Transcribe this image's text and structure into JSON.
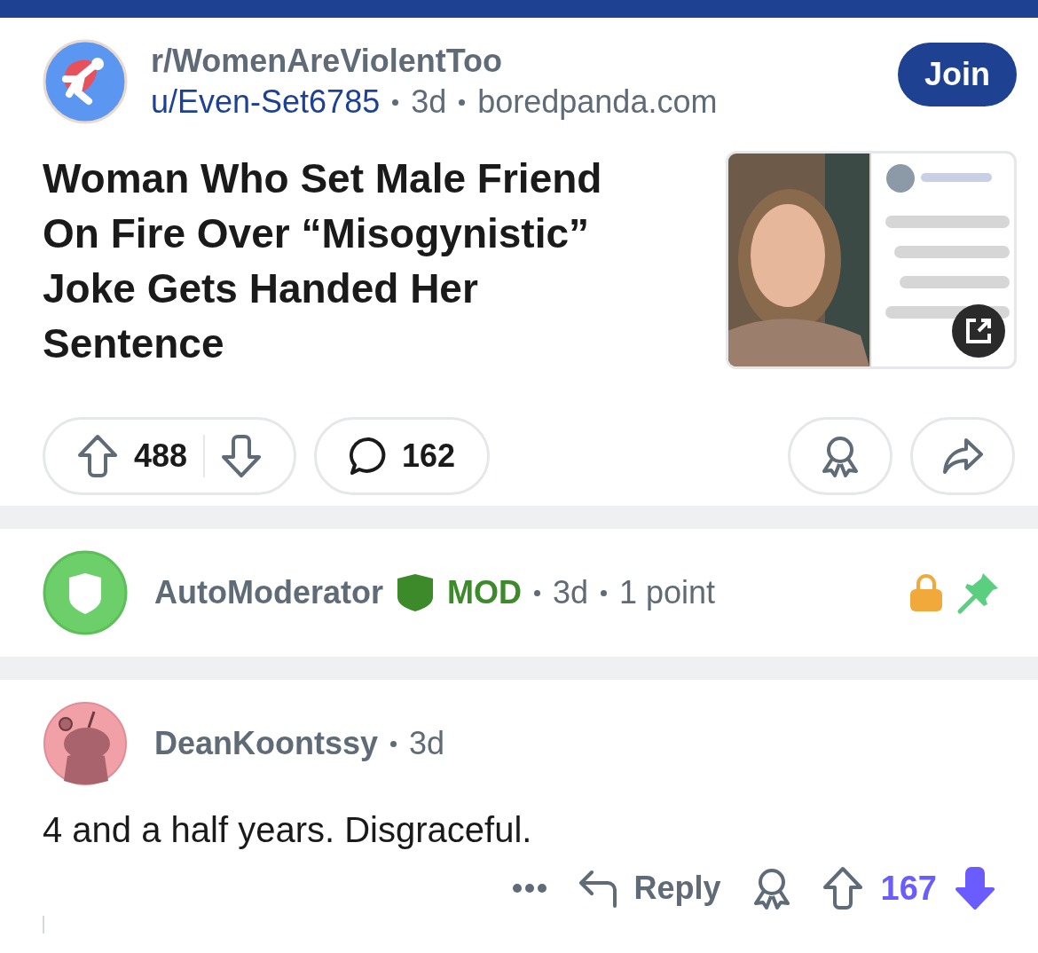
{
  "post": {
    "subreddit": "r/WomenAreViolentToo",
    "author": "u/Even-Set6785",
    "age": "3d",
    "domain": "boredpanda.com",
    "join_label": "Join",
    "title": "Woman Who Set Male Friend On Fire Over “Misogynistic” Joke Gets Handed Her Sentence",
    "score": "488",
    "upvoted": false,
    "downvoted": false,
    "comment_count": "162"
  },
  "comments": [
    {
      "kind": "mod",
      "author": "AutoModerator",
      "flair": "MOD",
      "age": "3d",
      "points": "1 point",
      "locked": true,
      "pinned": true
    },
    {
      "kind": "user",
      "author": "DeanKoontssy",
      "age": "3d",
      "body": "4 and a half years. Disgraceful.",
      "reply_label": "Reply",
      "score": "167",
      "upvoted": false,
      "downvoted": true
    }
  ]
}
